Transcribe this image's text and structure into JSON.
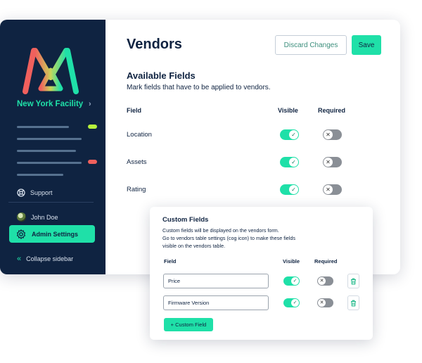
{
  "sidebar": {
    "facility": "New York Facility",
    "facility_chevron": "›",
    "support": "Support",
    "user": "John Doe",
    "admin_settings": "Admin Settings",
    "collapse": "Collapse sidebar",
    "collapse_icon": "«"
  },
  "header": {
    "title": "Vendors",
    "discard_label": "Discard Changes",
    "save_label": "Save"
  },
  "available_fields": {
    "title": "Available Fields",
    "description": "Mark fields that have to be applied to vendors.",
    "col_field": "Field",
    "col_visible": "Visible",
    "col_required": "Required",
    "rows": [
      {
        "label": "Location",
        "visible": true,
        "required": false
      },
      {
        "label": "Assets",
        "visible": true,
        "required": false
      },
      {
        "label": "Rating",
        "visible": true,
        "required": false
      }
    ]
  },
  "custom_fields": {
    "title": "Custom Fields",
    "desc_line1": "Custom fields will be displayed on the vendors form.",
    "desc_line2": "Go to vendors table settings (cog icon) to make these fields",
    "desc_line3": "visible on the vendors table.",
    "col_field": "Field",
    "col_visible": "Visible",
    "col_required": "Required",
    "rows": [
      {
        "value": "Price",
        "visible": true,
        "required": false
      },
      {
        "value": "Firmware Version",
        "visible": true,
        "required": false
      }
    ],
    "add_label": "+ Custom Field"
  },
  "icons": {
    "check": "✓",
    "cross": "✕"
  },
  "colors": {
    "accent": "#1fe0a8",
    "sidebar_bg": "#0f2341",
    "logo_red": "#f0605d",
    "logo_green": "#1fe0a8",
    "pill_green": "#b6f03c",
    "pill_red": "#f0605d"
  }
}
